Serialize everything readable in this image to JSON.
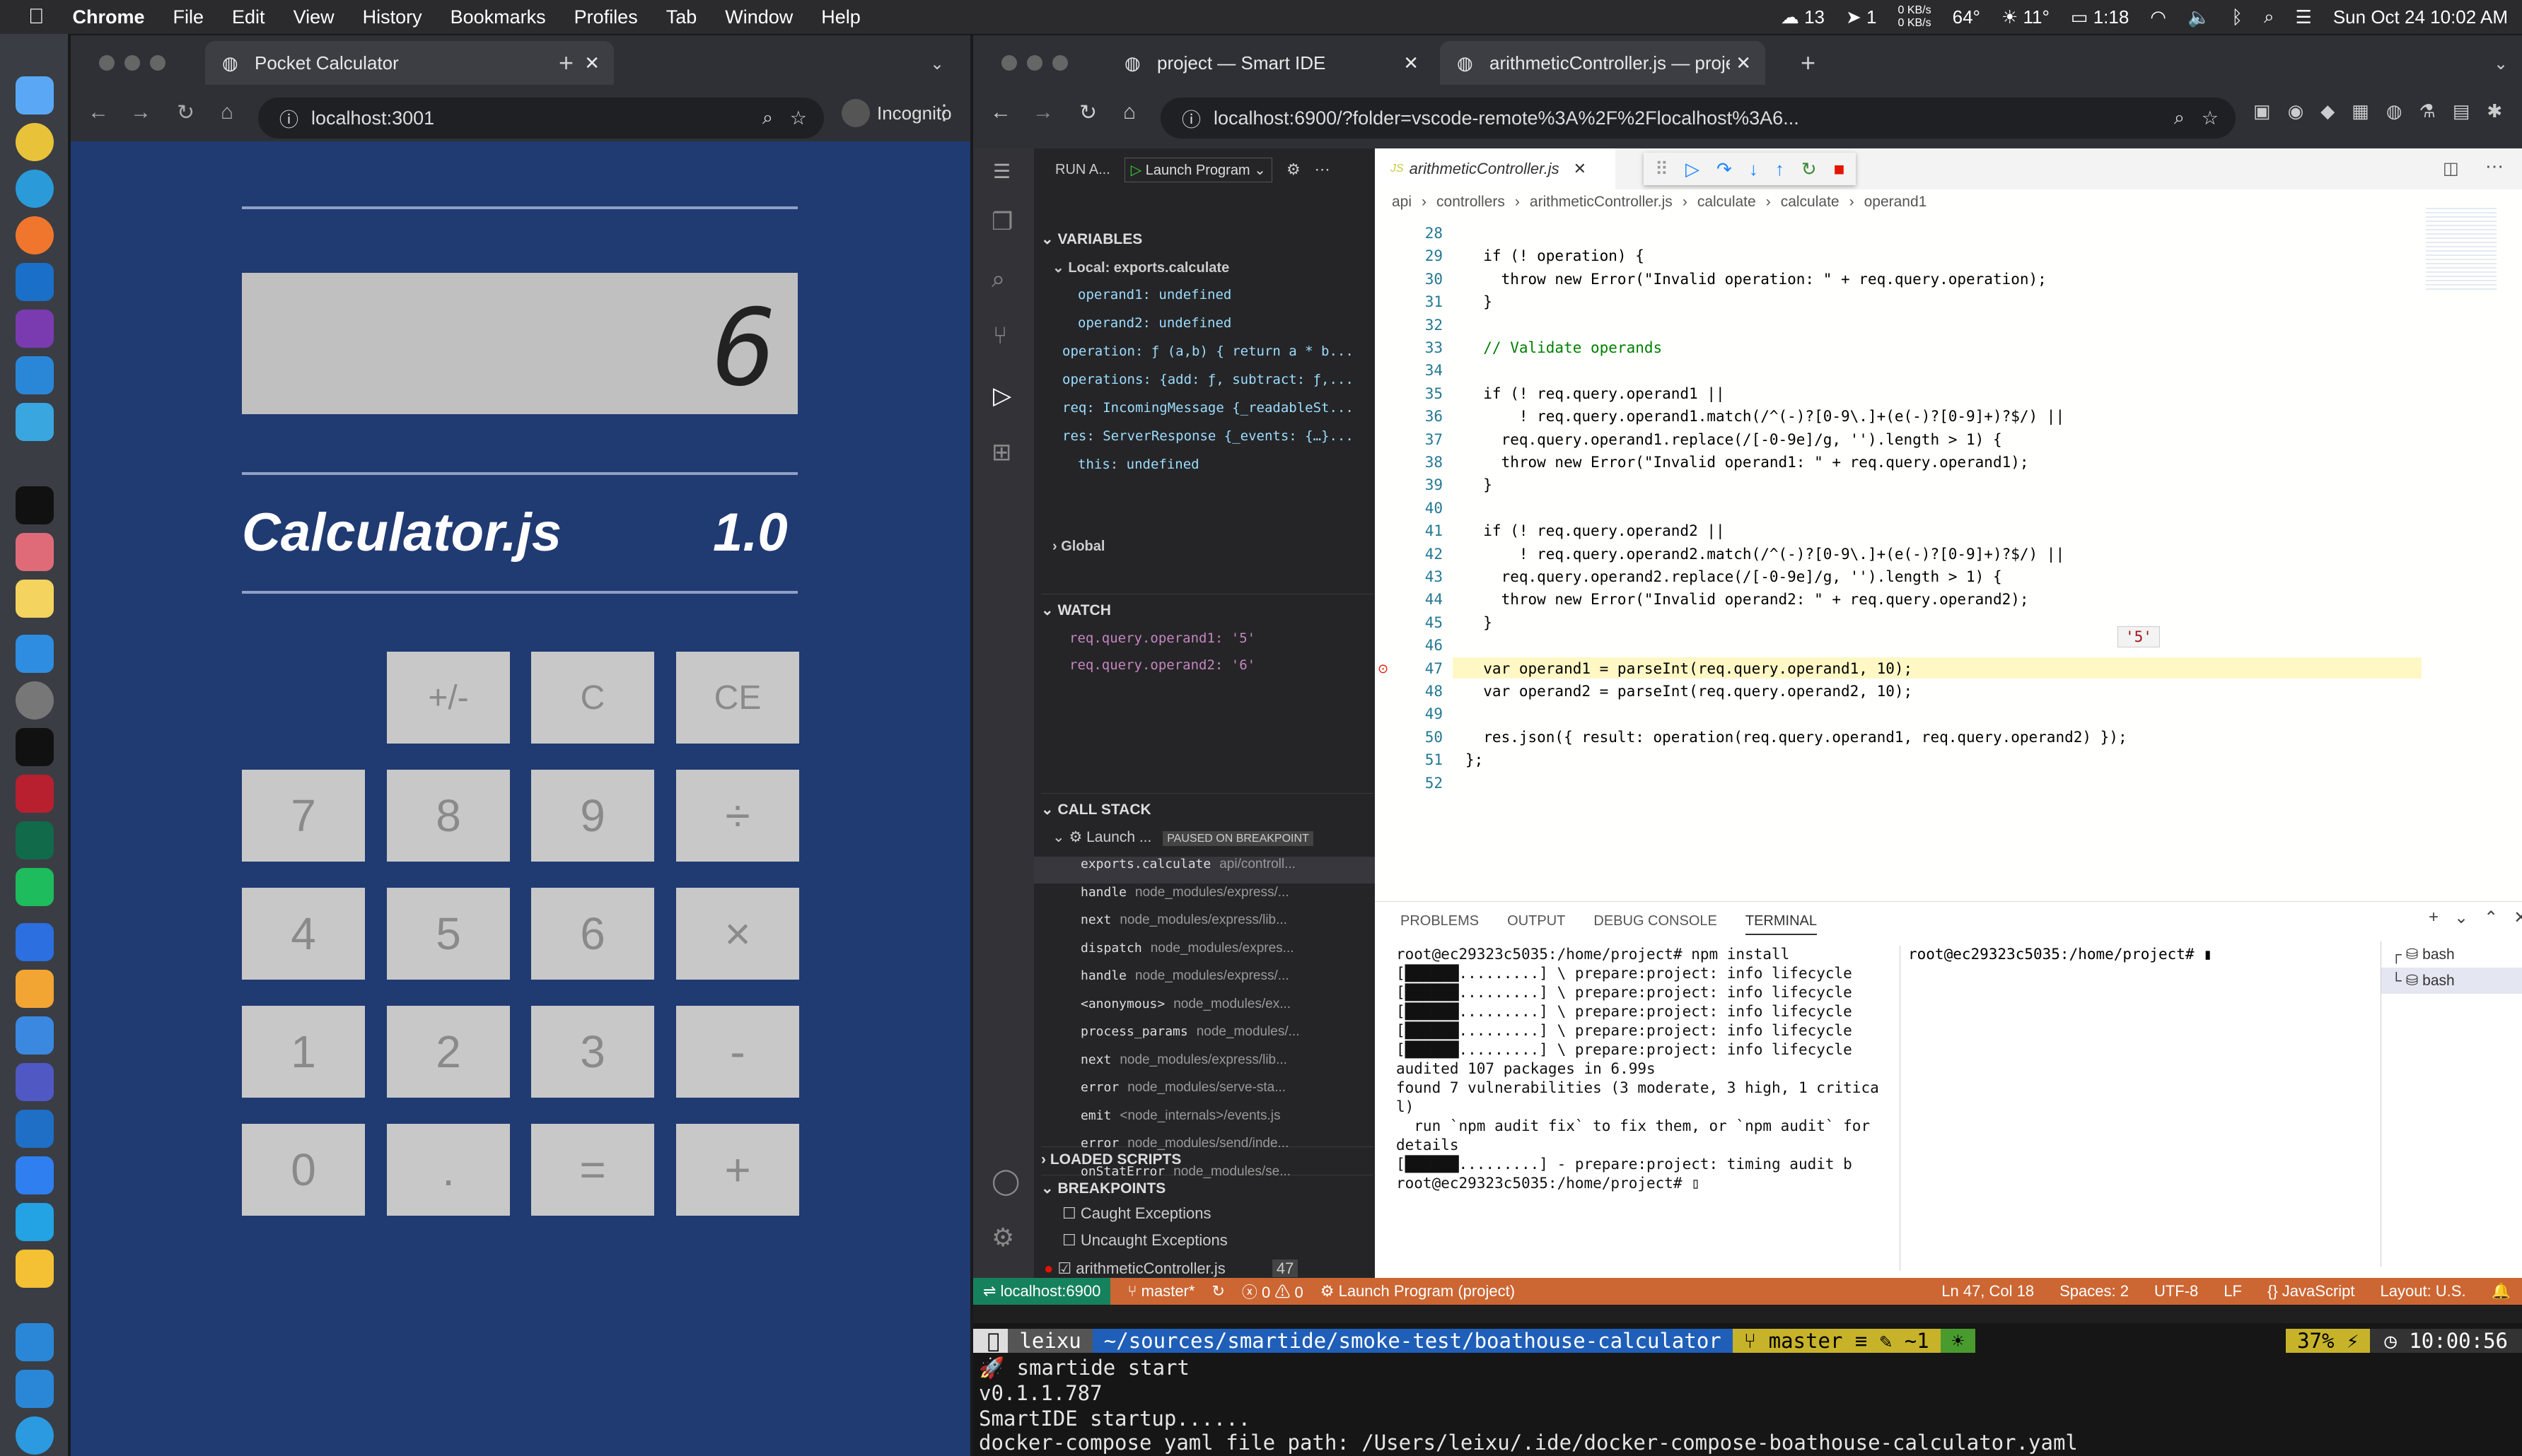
{
  "menubar": {
    "app": "Chrome",
    "items": [
      "File",
      "Edit",
      "View",
      "History",
      "Bookmarks",
      "Profiles",
      "Tab",
      "Window",
      "Help"
    ],
    "wechat_count": "13",
    "send_count": "1",
    "net_up": "0 KB/s",
    "net_down": "0 KB/s",
    "temp": "64°",
    "weather": "11°",
    "battery_time": "1:18",
    "clock": "Sun Oct 24  10:02 AM"
  },
  "calc_browser": {
    "tab_title": "Pocket Calculator",
    "url": "localhost:3001",
    "profile": "Incognito",
    "display": "6",
    "title": "Calculator.js",
    "version": "1.0",
    "buttons": [
      [
        "",
        "+/-",
        "C",
        "CE"
      ],
      [
        "7",
        "8",
        "9",
        "÷"
      ],
      [
        "4",
        "5",
        "6",
        "×"
      ],
      [
        "1",
        "2",
        "3",
        "-"
      ],
      [
        "0",
        ".",
        "=",
        "+"
      ]
    ]
  },
  "ide_browser": {
    "tabs": [
      "project — Smart IDE",
      "arithmeticController.js — proje"
    ],
    "url": "localhost:6900/?folder=vscode-remote%3A%2F%2Flocalhost%3A6..."
  },
  "debug": {
    "run_label": "RUN A...",
    "config": "Launch Program",
    "editor_tab": "arithmeticController.js",
    "breadcrumb": [
      "api",
      "controllers",
      "arithmeticController.js",
      "calculate",
      "calculate",
      "operand1"
    ],
    "variables_title": "VARIABLES",
    "local_scope": "Local: exports.calculate",
    "vars": [
      "operand1: undefined",
      "operand2: undefined",
      "operation: ƒ (a,b) { return a * b...",
      "operations: {add: ƒ, subtract: ƒ,...",
      "req: IncomingMessage {_readableSt...",
      "res: ServerResponse {_events: {…}...",
      "this: undefined"
    ],
    "global": "Global",
    "watch_title": "WATCH",
    "watch": [
      "req.query.operand1: '5'",
      "req.query.operand2: '6'"
    ],
    "callstack_title": "CALL STACK",
    "thread": "Launch ...",
    "paused": "PAUSED ON BREAKPOINT",
    "frames": [
      [
        "exports.calculate",
        "api/controll..."
      ],
      [
        "handle",
        "node_modules/express/..."
      ],
      [
        "next",
        "node_modules/express/lib..."
      ],
      [
        "dispatch",
        "node_modules/expres..."
      ],
      [
        "handle",
        "node_modules/express/..."
      ],
      [
        "<anonymous>",
        "node_modules/ex..."
      ],
      [
        "process_params",
        "node_modules/..."
      ],
      [
        "next",
        "node_modules/express/lib..."
      ],
      [
        "error",
        "node_modules/serve-sta..."
      ],
      [
        "emit",
        "<node_internals>/events.js"
      ],
      [
        "error",
        "node_modules/send/inde..."
      ],
      [
        "onStatError",
        "node_modules/se..."
      ]
    ],
    "loaded_scripts": "LOADED SCRIPTS",
    "breakpoints_title": "BREAKPOINTS",
    "bp_items": [
      "Caught Exceptions",
      "Uncaught Exceptions",
      "arithmeticController.js"
    ],
    "bp_line": "47",
    "hover_value": "'5'"
  },
  "code_lines": [
    {
      "n": "28",
      "t": ""
    },
    {
      "n": "29",
      "t": "  if (! operation) {"
    },
    {
      "n": "30",
      "t": "    throw new Error(\"Invalid operation: \" + req.query.operation);"
    },
    {
      "n": "31",
      "t": "  }"
    },
    {
      "n": "32",
      "t": ""
    },
    {
      "n": "33",
      "t": "  // Validate operands"
    },
    {
      "n": "34",
      "t": ""
    },
    {
      "n": "35",
      "t": "  if (! req.query.operand1 ||"
    },
    {
      "n": "36",
      "t": "      ! req.query.operand1.match(/^(-)?[0-9\\.]+(e(-)?[0-9]+)?$/) ||"
    },
    {
      "n": "37",
      "t": "    req.query.operand1.replace(/[-0-9e]/g, '').length > 1) {"
    },
    {
      "n": "38",
      "t": "    throw new Error(\"Invalid operand1: \" + req.query.operand1);"
    },
    {
      "n": "39",
      "t": "  }"
    },
    {
      "n": "40",
      "t": ""
    },
    {
      "n": "41",
      "t": "  if (! req.query.operand2 ||"
    },
    {
      "n": "42",
      "t": "      ! req.query.operand2.match(/^(-)?[0-9\\.]+(e(-)?[0-9]+)?$/) ||"
    },
    {
      "n": "43",
      "t": "    req.query.operand2.replace(/[-0-9e]/g, '').length > 1) {"
    },
    {
      "n": "44",
      "t": "    throw new Error(\"Invalid operand2: \" + req.query.operand2);"
    },
    {
      "n": "45",
      "t": "  }"
    },
    {
      "n": "46",
      "t": ""
    },
    {
      "n": "47",
      "t": "  var operand1 = parseInt(req.query.operand1, 10);"
    },
    {
      "n": "48",
      "t": "  var operand2 = parseInt(req.query.operand2, 10);"
    },
    {
      "n": "49",
      "t": ""
    },
    {
      "n": "50",
      "t": "  res.json({ result: operation(req.query.operand1, req.query.operand2) });"
    },
    {
      "n": "51",
      "t": "};"
    },
    {
      "n": "52",
      "t": ""
    }
  ],
  "panel": {
    "tabs": [
      "PROBLEMS",
      "OUTPUT",
      "DEBUG CONSOLE",
      "TERMINAL"
    ],
    "term_left": [
      "root@ec29323c5035:/home/project# npm install",
      "[██████.........] \\ prepare:project: info lifecycle",
      "[██████.........] \\ prepare:project: info lifecycle",
      "[██████.........] \\ prepare:project: info lifecycle",
      "[██████.........] \\ prepare:project: info lifecycle",
      "[██████.........] \\ prepare:project: info lifecycle",
      "audited 107 packages in 6.99s",
      "found 7 vulnerabilities (3 moderate, 3 high, 1 critica",
      "l)",
      "  run `npm audit fix` to fix them, or `npm audit` for",
      "details",
      "[██████.........] - prepare:project: timing audit b",
      "root@ec29323c5035:/home/project# ▯"
    ],
    "term_right": "root@ec29323c5035:/home/project# ▮",
    "shells": [
      "bash",
      "bash"
    ]
  },
  "status": {
    "remote": "localhost:6900",
    "branch": "master*",
    "errors": "0",
    "warnings": "0",
    "launch": "Launch Program (project)",
    "pos": "Ln 47, Col 18",
    "spaces": "Spaces: 2",
    "enc": "UTF-8",
    "eol": "LF",
    "lang": "JavaScript",
    "layout": "Layout: U.S."
  },
  "terminal": {
    "user": "leixu",
    "path": "~/sources/smartide/smoke-test/boathouse-calculator",
    "git": "master ≡ ✎ ~1",
    "battery": "37%",
    "time": "10:00:56",
    "lines": [
      "🚀  smartide start",
      "v0.1.1.787",
      "SmartIDE startup......",
      "docker-compose yaml file path: /Users/leixu/.ide/docker-compose-boathouse-calculator.yaml"
    ]
  }
}
